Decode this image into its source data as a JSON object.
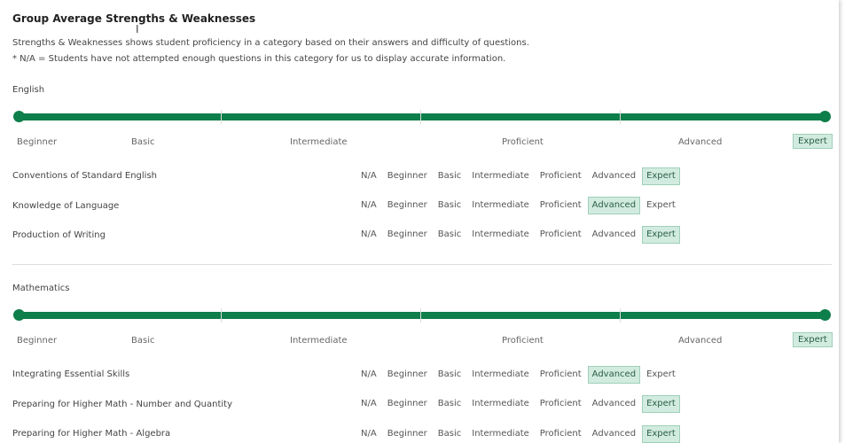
{
  "title": "Group Average Strengths & Weaknesses",
  "description": "Strengths & Weaknesses shows student proficiency in a category based on their answers and difficulty of questions.",
  "note": "* N/A = Students have not attempted enough questions in this category for us to display accurate information.",
  "scale_levels": [
    "Beginner",
    "Basic",
    "Intermediate",
    "Proficient",
    "Advanced",
    "Expert"
  ],
  "category_levels": [
    "N/A",
    "Beginner",
    "Basic",
    "Intermediate",
    "Proficient",
    "Advanced",
    "Expert"
  ],
  "subjects": [
    {
      "name": "English",
      "overall_level": "Expert",
      "categories": [
        {
          "name": "Conventions of Standard English",
          "level": "Expert"
        },
        {
          "name": "Knowledge of Language",
          "level": "Advanced"
        },
        {
          "name": "Production of Writing",
          "level": "Expert"
        }
      ]
    },
    {
      "name": "Mathematics",
      "overall_level": "Expert",
      "categories": [
        {
          "name": "Integrating Essential Skills",
          "level": "Advanced"
        },
        {
          "name": "Preparing for Higher Math - Number and Quantity",
          "level": "Expert"
        },
        {
          "name": "Preparing for Higher Math - Algebra",
          "level": "Expert"
        }
      ]
    }
  ],
  "colors": {
    "bar": "#0e7e4a",
    "highlight_bg": "#d2ebe0",
    "highlight_border": "#9fd0b9"
  }
}
